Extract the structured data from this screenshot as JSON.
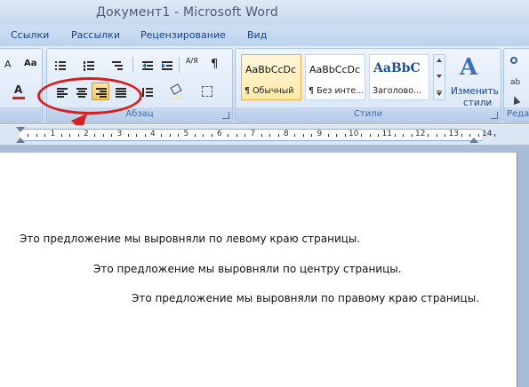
{
  "window": {
    "title": "Документ1 - Microsoft Word"
  },
  "tabs": [
    "Ссылки",
    "Рассылки",
    "Рецензирование",
    "Вид"
  ],
  "ribbon": {
    "groups": {
      "paragraph": "Абзац",
      "styles": "Стили",
      "editing": "Реда"
    },
    "styles": [
      {
        "sample": "AaBbCcDc",
        "name": "¶ Обычный",
        "active": true
      },
      {
        "sample": "AaBbCcDc",
        "name": "¶ Без инте...",
        "active": false
      },
      {
        "sample": "AaBbC",
        "name": "Заголово...",
        "active": false
      }
    ],
    "change_styles": {
      "line1": "Изменить",
      "line2": "стили"
    },
    "font_color_letter": "A",
    "pilcrow": "¶",
    "sort_label": "А/Я",
    "alignment": {
      "selected": "right"
    }
  },
  "ruler": {
    "numbers": [
      "1",
      "2",
      "3",
      "4",
      "5",
      "6",
      "7",
      "8",
      "9",
      "10",
      "11",
      "12",
      "13",
      "14"
    ]
  },
  "document": {
    "lines": [
      "Это предложение мы выровняли по левому краю страницы.",
      "Это предложение мы выровняли по центру страницы.",
      "Это предложение мы выровняли по правому краю страницы."
    ]
  },
  "colors": {
    "highlight": "#d42021",
    "pressed": "#f7c75c",
    "accent": "#15428b"
  }
}
